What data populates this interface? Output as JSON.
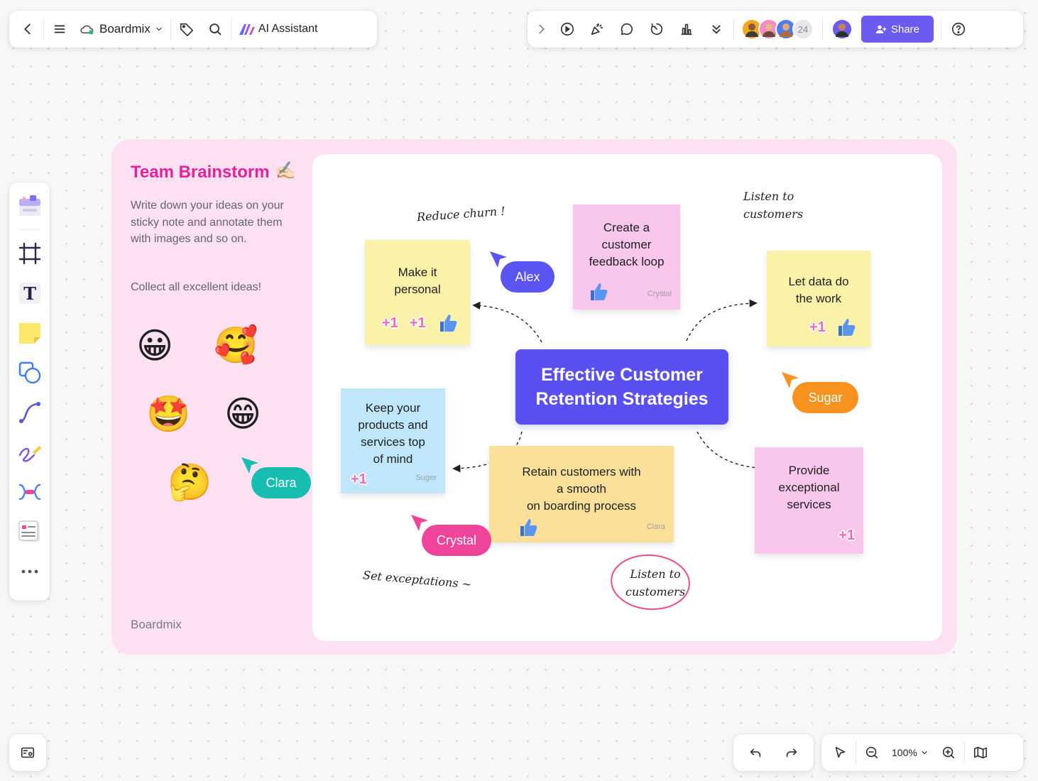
{
  "toolbar": {
    "board_name": "Boardmix",
    "ai_assistant_label": "AI Assistant",
    "share_label": "Share",
    "collaborator_count": "24"
  },
  "frame": {
    "title": "Team Brainstorm",
    "title_emoji": "✍🏻",
    "description": "Write down your ideas on your sticky note and annotate them with images and so on.",
    "collect_text": "Collect all excellent ideas!",
    "brand": "Boardmix",
    "emojis": [
      "😀",
      "🥰",
      "🤩",
      "😁",
      "🤔"
    ]
  },
  "center_node": {
    "line1": "Effective Customer",
    "line2": "Retention Strategies"
  },
  "stickies": {
    "make_personal": {
      "line1": "Make it",
      "line2": "personal"
    },
    "feedback_loop": {
      "line1": "Create a",
      "line2": "customer",
      "line3": "feedback loop",
      "author": "Crystal"
    },
    "let_data": {
      "line1": "Let data do",
      "line2": "the work"
    },
    "keep_products": {
      "line1": "Keep your",
      "line2": "products and",
      "line3": "services top",
      "line4": "of mind",
      "author": "Suger"
    },
    "retain": {
      "line1": "Retain customers with",
      "line2": "a smooth",
      "line3": "on boarding process",
      "author": "Clara"
    },
    "exceptional": {
      "line1": "Provide",
      "line2": "exceptional",
      "line3": "services"
    }
  },
  "reactions": {
    "plus_one": "+1"
  },
  "annotations": {
    "reduce_churn": "Reduce churn !",
    "listen_top_1": "Listen to",
    "listen_top_2": "customers",
    "set_expectations": "Set exceptations ~",
    "listen_bottom_1": "Listen to",
    "listen_bottom_2": "customers"
  },
  "cursors": {
    "alex": {
      "name": "Alex",
      "color": "#5a55f2"
    },
    "sugar": {
      "name": "Sugar",
      "color": "#f7931e"
    },
    "clara": {
      "name": "Clara",
      "color": "#17bdb1"
    },
    "crystal": {
      "name": "Crystal",
      "color": "#f0449b"
    }
  },
  "zoom": {
    "level": "100%"
  },
  "colors": {
    "accent": "#6b5bf0",
    "frame_background": "#fde1f2",
    "title_pink": "#e6219a",
    "center_node": "#5a4ff0"
  }
}
